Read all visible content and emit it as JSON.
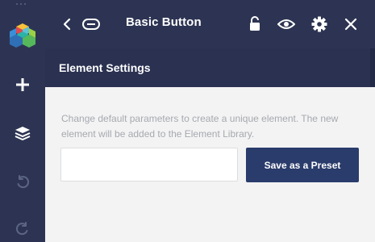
{
  "header": {
    "title": "Basic Button",
    "icons": [
      "chevron-left-icon",
      "element-type-icon",
      "lock-icon",
      "eye-icon",
      "gear-icon",
      "close-icon"
    ]
  },
  "sidebar": {
    "icons": [
      "logo-icon",
      "plus-icon",
      "layers-icon",
      "undo-icon",
      "redo-icon"
    ]
  },
  "section": {
    "title": "Element Settings"
  },
  "preset": {
    "description": "Change default parameters to create a unique element. The new element will be added to the Element Library.",
    "input_value": "",
    "input_placeholder": "",
    "save_label": "Save as a Preset"
  },
  "colors": {
    "chrome": "#2d3453",
    "section_bar": "#2a3151",
    "primary_button": "#2a3c6b",
    "content_bg": "#f3f3f3"
  }
}
